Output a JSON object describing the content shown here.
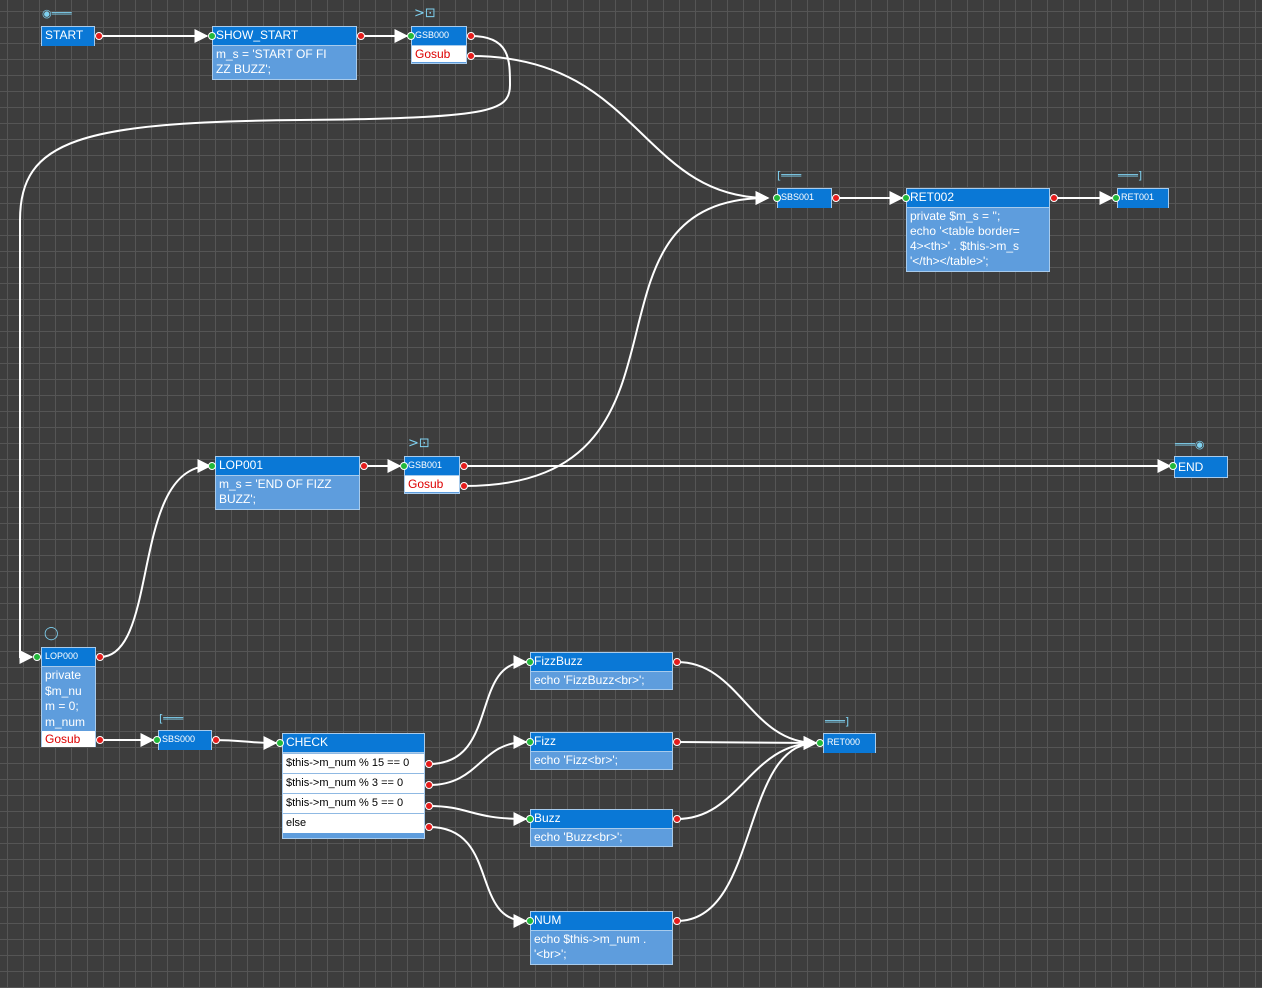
{
  "nodes": {
    "start": {
      "title": "START"
    },
    "show_start": {
      "title": "SHOW_START",
      "body": "m_s = 'START OF FI\nZZ BUZZ';"
    },
    "gsb000": {
      "title": "GSB000",
      "gosub": "Gosub"
    },
    "sbs001": {
      "title": "SBS001"
    },
    "ret002": {
      "title": "RET002",
      "body": "private $m_s = '';\necho '<table border=\n4><th>' . $this->m_s\n'</th></table>';"
    },
    "ret001": {
      "title": "RET001"
    },
    "lop001": {
      "title": "LOP001",
      "body": "m_s = 'END OF FIZZ\nBUZZ';"
    },
    "gsb001": {
      "title": "GSB001",
      "gosub": "Gosub"
    },
    "end": {
      "title": "END"
    },
    "lop000": {
      "title": "LOP000",
      "body": "private\n$m_nu\nm = 0;\nm_num",
      "gosub": "Gosub"
    },
    "sbs000": {
      "title": "SBS000"
    },
    "check": {
      "title": "CHECK",
      "conditions": [
        "$this->m_num % 15 == 0",
        "$this->m_num % 3 == 0",
        "$this->m_num % 5 == 0",
        "else"
      ]
    },
    "fizzbuzz": {
      "title": "FizzBuzz",
      "body": "echo 'FizzBuzz<br>';"
    },
    "fizz": {
      "title": "Fizz",
      "body": "echo 'Fizz<br>';"
    },
    "buzz": {
      "title": "Buzz",
      "body": "echo 'Buzz<br>';"
    },
    "num": {
      "title": "NUM",
      "body": "echo $this->m_num .\n'<br>';"
    },
    "ret000": {
      "title": "RET000"
    }
  },
  "markers": {
    "start_icon": "◉═══",
    "gosub_icon": ">⊡",
    "sub_start_icon": "[═══",
    "sub_end_icon": "═══]",
    "end_icon": "═══◉",
    "loop_icon": "◯"
  },
  "colors": {
    "canvas": "#3d3d3d",
    "grid": "#555555",
    "node_title": "#0a78d6",
    "node_body": "#5e9ddd",
    "wire": "#ffffff",
    "port_in": "#22b83a",
    "port_out": "#e51c1c",
    "gosub_text": "#dd0000",
    "marker": "#7fd1f0"
  }
}
